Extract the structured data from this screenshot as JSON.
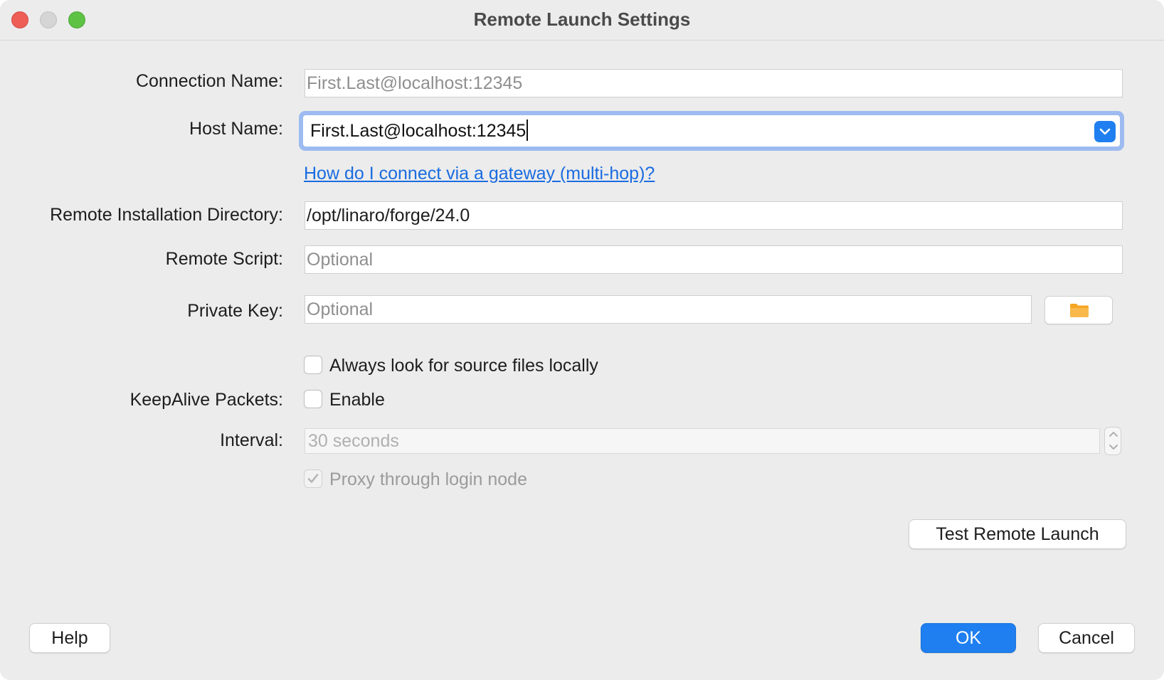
{
  "window": {
    "title": "Remote Launch Settings"
  },
  "form": {
    "connection_name": {
      "label": "Connection Name:",
      "value": "",
      "placeholder": "First.Last@localhost:12345"
    },
    "host_name": {
      "label": "Host Name:",
      "value": "First.Last@localhost:12345"
    },
    "gateway_link": "How do I connect via a gateway (multi-hop)?",
    "remote_install_dir": {
      "label": "Remote Installation Directory:",
      "value": "/opt/linaro/forge/24.0"
    },
    "remote_script": {
      "label": "Remote Script:",
      "value": "",
      "placeholder": "Optional"
    },
    "private_key": {
      "label": "Private Key:",
      "value": "",
      "placeholder": "Optional",
      "browse_icon": "folder-icon"
    },
    "source_locally": {
      "label": "Always look for source files locally",
      "checked": false
    },
    "keepalive": {
      "label": "KeepAlive Packets:",
      "checkbox_label": "Enable",
      "checked": false
    },
    "interval": {
      "label": "Interval:",
      "value": "30 seconds",
      "enabled": false
    },
    "proxy": {
      "label": "Proxy through login node",
      "checked": true,
      "enabled": false
    }
  },
  "buttons": {
    "test": "Test Remote Launch",
    "help": "Help",
    "ok": "OK",
    "cancel": "Cancel"
  },
  "colors": {
    "accent": "#1f7ff0",
    "link": "#1a6ce0",
    "focus_ring": "#9dbbf0",
    "close": "#ee5e57",
    "maximize": "#5ec245"
  }
}
